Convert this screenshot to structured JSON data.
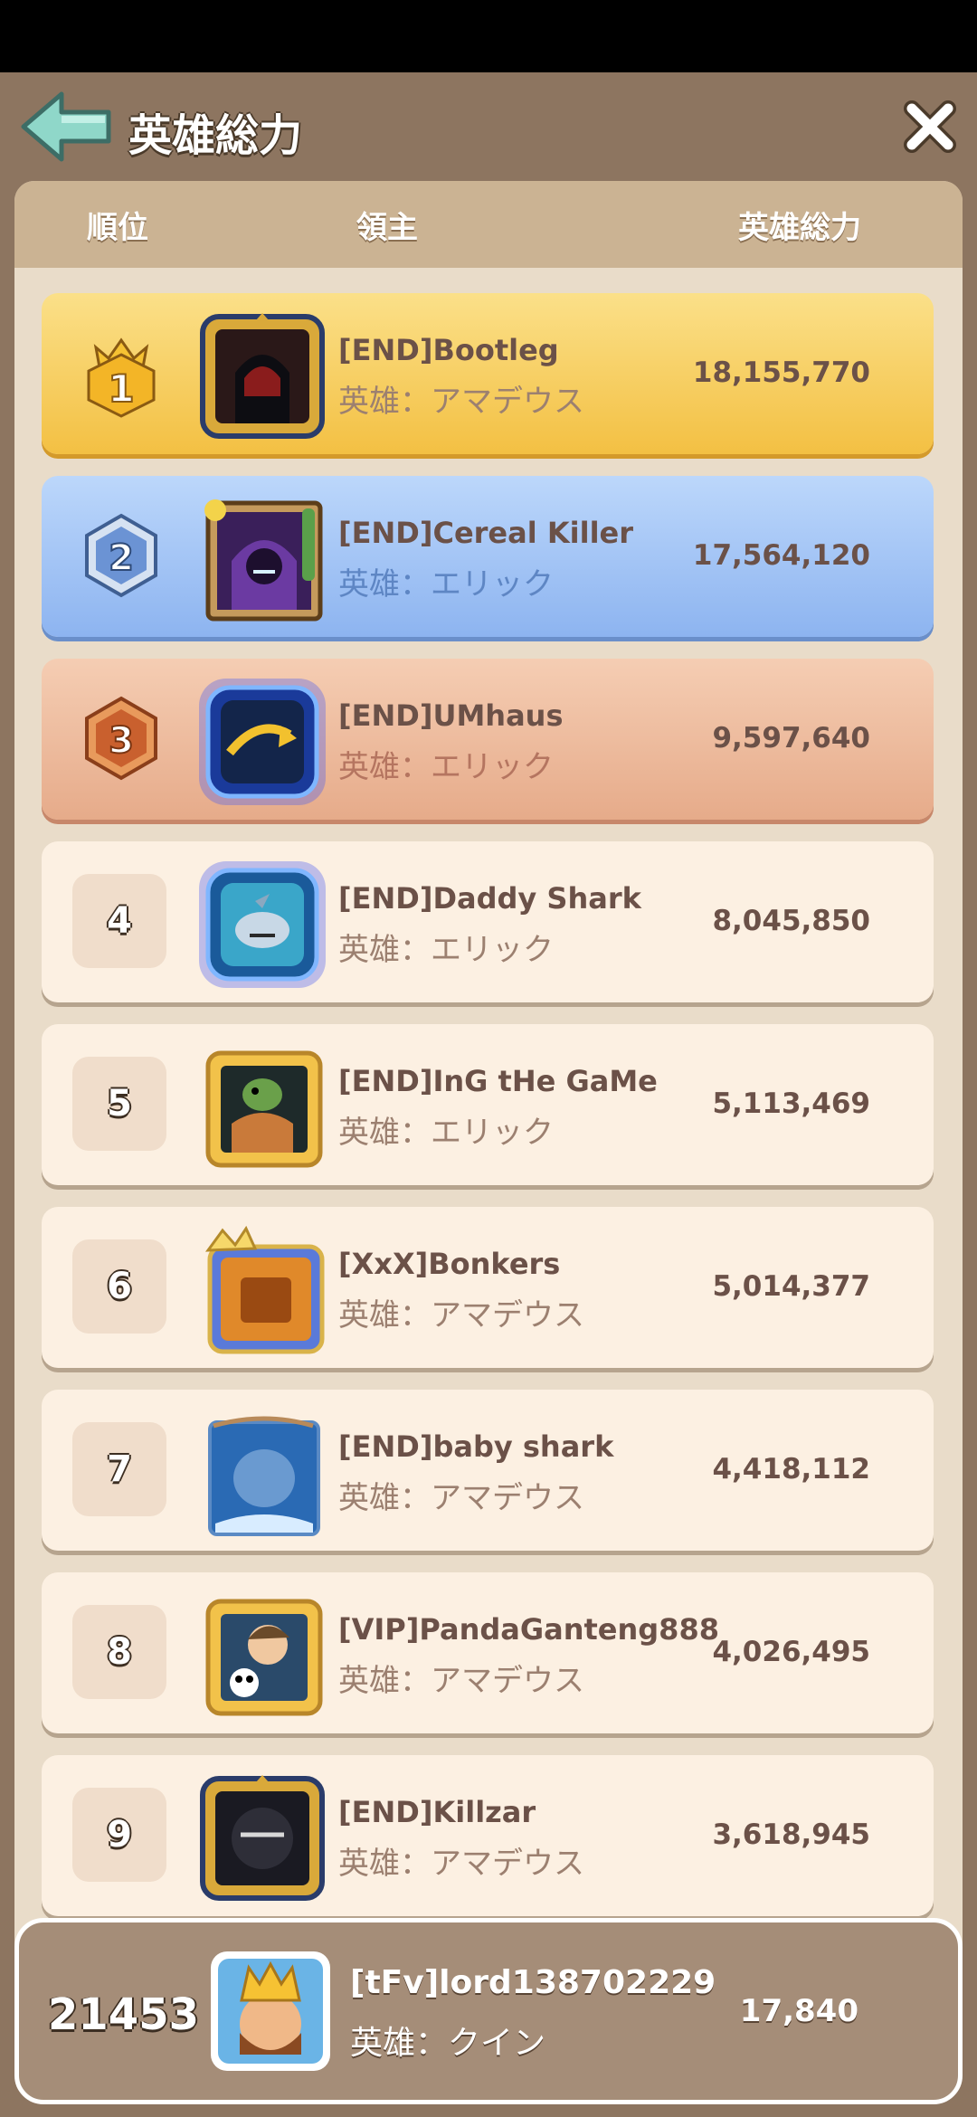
{
  "header": {
    "title": "英雄総力",
    "back_icon": "arrow-left-icon",
    "close_icon": "close-icon"
  },
  "columns": {
    "rank": "順位",
    "lord": "領主",
    "power": "英雄総力"
  },
  "rows": [
    {
      "rank": "1",
      "name": "[END]Bootleg",
      "hero": "英雄：アマデウス",
      "power": "18,155,770",
      "tier": "gold"
    },
    {
      "rank": "2",
      "name": "[END]Cereal Killer",
      "hero": "英雄：エリック",
      "power": "17,564,120",
      "tier": "silver"
    },
    {
      "rank": "3",
      "name": "[END]UMhaus",
      "hero": "英雄：エリック",
      "power": "9,597,640",
      "tier": "bronze"
    },
    {
      "rank": "4",
      "name": "[END]Daddy Shark",
      "hero": "英雄：エリック",
      "power": "8,045,850",
      "tier": "plain"
    },
    {
      "rank": "5",
      "name": "[END]InG tHe GaMe",
      "hero": "英雄：エリック",
      "power": "5,113,469",
      "tier": "plain"
    },
    {
      "rank": "6",
      "name": "[XxX]Bonkers",
      "hero": "英雄：アマデウス",
      "power": "5,014,377",
      "tier": "plain"
    },
    {
      "rank": "7",
      "name": "[END]baby shark",
      "hero": "英雄：アマデウス",
      "power": "4,418,112",
      "tier": "plain"
    },
    {
      "rank": "8",
      "name": "[VIP]PandaGanteng888",
      "hero": "英雄：アマデウス",
      "power": "4,026,495",
      "tier": "plain"
    },
    {
      "rank": "9",
      "name": "[END]Killzar",
      "hero": "英雄：アマデウス",
      "power": "3,618,945",
      "tier": "plain"
    }
  ],
  "self": {
    "rank": "21453",
    "name": "[tFv]lord138702229",
    "hero": "英雄：クイン",
    "power": "17,840"
  },
  "colors": {
    "gold": "#f3c043",
    "silver": "#8db4f0",
    "bronze": "#e6ab8a",
    "panel": "#8d7560"
  }
}
